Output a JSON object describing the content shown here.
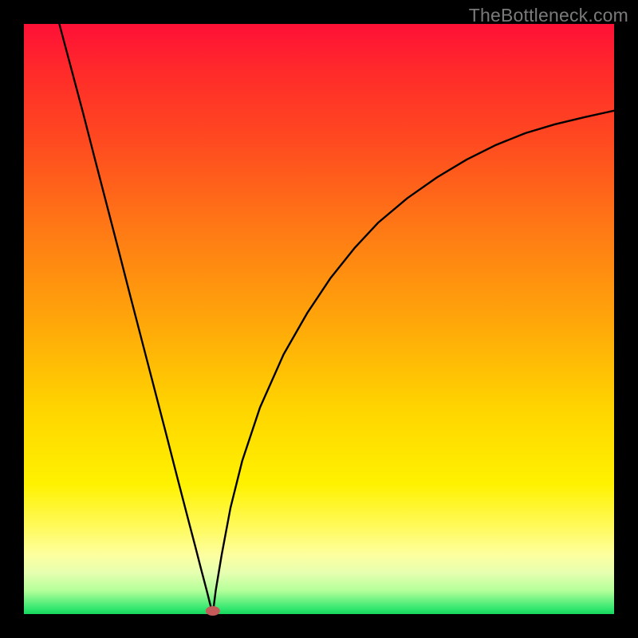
{
  "watermark_text": "TheBottleneck.com",
  "chart_data": {
    "type": "line",
    "title": "",
    "xlabel": "",
    "ylabel": "",
    "x_range": [
      0,
      100
    ],
    "y_range": [
      0,
      100
    ],
    "curve_description": "V-shaped curve: steep linear descent from top-left edge down to a sharp minimum near x≈32 at the bottom (y≈0), then a concave-down ascent toward the right edge reaching y≈85 at x=100. Minimum marked with a small rounded red capsule.",
    "gradient_stops": [
      {
        "pos": 0.0,
        "color": "#ff1037"
      },
      {
        "pos": 0.08,
        "color": "#ff2a2a"
      },
      {
        "pos": 0.2,
        "color": "#ff4a20"
      },
      {
        "pos": 0.35,
        "color": "#ff7a15"
      },
      {
        "pos": 0.5,
        "color": "#ffa50a"
      },
      {
        "pos": 0.65,
        "color": "#ffd400"
      },
      {
        "pos": 0.78,
        "color": "#fff200"
      },
      {
        "pos": 0.86,
        "color": "#fffb66"
      },
      {
        "pos": 0.9,
        "color": "#fdffa0"
      },
      {
        "pos": 0.93,
        "color": "#e6ffb0"
      },
      {
        "pos": 0.96,
        "color": "#b5ff9a"
      },
      {
        "pos": 0.99,
        "color": "#35e870"
      },
      {
        "pos": 1.0,
        "color": "#17d65c"
      }
    ],
    "series": [
      {
        "name": "bottleneck-curve",
        "points": [
          {
            "x": 6.0,
            "y": 100.0
          },
          {
            "x": 8.0,
            "y": 92.5
          },
          {
            "x": 10.0,
            "y": 85.0
          },
          {
            "x": 12.0,
            "y": 77.2
          },
          {
            "x": 14.0,
            "y": 69.5
          },
          {
            "x": 16.0,
            "y": 61.8
          },
          {
            "x": 18.0,
            "y": 54.0
          },
          {
            "x": 20.0,
            "y": 46.3
          },
          {
            "x": 22.0,
            "y": 38.6
          },
          {
            "x": 24.0,
            "y": 30.9
          },
          {
            "x": 26.0,
            "y": 23.1
          },
          {
            "x": 28.0,
            "y": 15.4
          },
          {
            "x": 29.0,
            "y": 11.6
          },
          {
            "x": 30.0,
            "y": 7.7
          },
          {
            "x": 31.0,
            "y": 3.9
          },
          {
            "x": 31.5,
            "y": 1.9
          },
          {
            "x": 32.0,
            "y": 0.0
          },
          {
            "x": 32.5,
            "y": 4.0
          },
          {
            "x": 33.5,
            "y": 10.0
          },
          {
            "x": 35.0,
            "y": 18.0
          },
          {
            "x": 37.0,
            "y": 26.0
          },
          {
            "x": 40.0,
            "y": 35.0
          },
          {
            "x": 44.0,
            "y": 44.0
          },
          {
            "x": 48.0,
            "y": 51.0
          },
          {
            "x": 52.0,
            "y": 57.0
          },
          {
            "x": 56.0,
            "y": 62.0
          },
          {
            "x": 60.0,
            "y": 66.3
          },
          {
            "x": 65.0,
            "y": 70.5
          },
          {
            "x": 70.0,
            "y": 74.0
          },
          {
            "x": 75.0,
            "y": 77.0
          },
          {
            "x": 80.0,
            "y": 79.5
          },
          {
            "x": 85.0,
            "y": 81.5
          },
          {
            "x": 90.0,
            "y": 83.0
          },
          {
            "x": 95.0,
            "y": 84.2
          },
          {
            "x": 100.0,
            "y": 85.3
          }
        ]
      }
    ],
    "minimum_marker": {
      "x": 32.0,
      "y": 0.0,
      "rx": 9,
      "ry": 6,
      "fill": "#c55a5a"
    }
  }
}
